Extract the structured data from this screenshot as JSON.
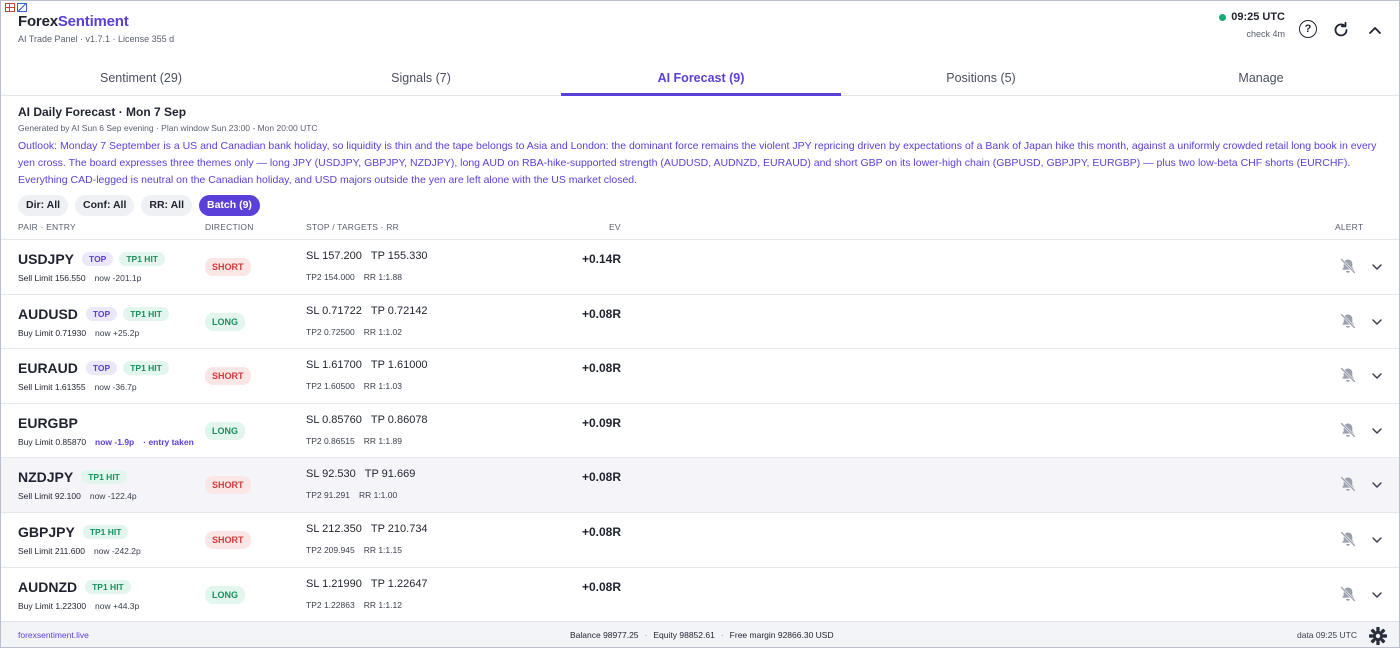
{
  "header": {
    "brand_part1": "Forex",
    "brand_part2": "Sentiment",
    "subtitle": "AI Trade Panel · v1.7.1 · License 355 d",
    "time": "09:25 UTC",
    "check": "check 4m",
    "help_label": "?",
    "status_color": "#19a974"
  },
  "tabs": [
    {
      "label": "Sentiment (29)",
      "active": false
    },
    {
      "label": "Signals (7)",
      "active": false
    },
    {
      "label": "AI Forecast (9)",
      "active": true
    },
    {
      "label": "Positions (5)",
      "active": false
    },
    {
      "label": "Manage",
      "active": false
    }
  ],
  "forecast": {
    "title": "AI Daily Forecast · Mon 7 Sep",
    "generated": "Generated by AI Sun 6 Sep evening · Plan window Sun 23:00 - Mon 20:00 UTC",
    "outlook": "Outlook: Monday 7 September is a US and Canadian bank holiday, so liquidity is thin and the tape belongs to Asia and London: the dominant force remains the violent JPY repricing driven by expectations of a Bank of Japan hike this month, against a uniformly crowded retail long book in every yen cross. The board expresses three themes only — long JPY (USDJPY, GBPJPY, NZDJPY), long AUD on RBA-hike-supported strength (AUDUSD, AUDNZD, EURAUD) and short GBP on its lower-high chain (GBPUSD, GBPJPY, EURGBP) — plus two low-beta CHF shorts (EURCHF). Everything CAD-legged is neutral on the Canadian holiday, and USD majors outside the yen are left alone with the US market closed."
  },
  "filters": [
    {
      "label": "Dir: All",
      "active": false
    },
    {
      "label": "Conf: All",
      "active": false
    },
    {
      "label": "RR: All",
      "active": false
    },
    {
      "label": "Batch (9)",
      "active": true
    }
  ],
  "columns": {
    "pair": "PAIR · ENTRY",
    "direction": "DIRECTION",
    "stops": "STOP / TARGETS · RR",
    "ev": "EV",
    "alert": "ALERT"
  },
  "rows": [
    {
      "pair": "USDJPY",
      "top": "TOP",
      "tp1": "TP1 HIT",
      "entry": "Sell Limit 156.550",
      "now": "now -201.1p",
      "note": "",
      "dir": "SHORT",
      "sl": "SL 157.200",
      "tp": "TP 155.330",
      "tp2": "TP2 154.000",
      "rr": "RR 1:1.88",
      "ev": "+0.14R"
    },
    {
      "pair": "AUDUSD",
      "top": "TOP",
      "tp1": "TP1 HIT",
      "entry": "Buy Limit 0.71930",
      "now": "now +25.2p",
      "note": "",
      "dir": "LONG",
      "sl": "SL 0.71722",
      "tp": "TP 0.72142",
      "tp2": "TP2 0.72500",
      "rr": "RR 1:1.02",
      "ev": "+0.08R"
    },
    {
      "pair": "EURAUD",
      "top": "TOP",
      "tp1": "TP1 HIT",
      "entry": "Sell Limit 1.61355",
      "now": "now -36.7p",
      "note": "",
      "dir": "SHORT",
      "sl": "SL 1.61700",
      "tp": "TP 1.61000",
      "tp2": "TP2 1.60500",
      "rr": "RR 1:1.03",
      "ev": "+0.08R"
    },
    {
      "pair": "EURGBP",
      "top": "",
      "tp1": "",
      "entry": "Buy Limit 0.85870",
      "now": "now -1.9p",
      "note": "· entry taken",
      "dir": "LONG",
      "sl": "SL 0.85760",
      "tp": "TP 0.86078",
      "tp2": "TP2 0.86515",
      "rr": "RR 1:1.89",
      "ev": "+0.09R"
    },
    {
      "pair": "NZDJPY",
      "top": "",
      "tp1": "TP1 HIT",
      "entry": "Sell Limit 92.100",
      "now": "now -122.4p",
      "note": "",
      "dir": "SHORT",
      "sl": "SL 92.530",
      "tp": "TP 91.669",
      "tp2": "TP2 91.291",
      "rr": "RR 1:1.00",
      "ev": "+0.08R"
    },
    {
      "pair": "GBPJPY",
      "top": "",
      "tp1": "TP1 HIT",
      "entry": "Sell Limit 211.600",
      "now": "now -242.2p",
      "note": "",
      "dir": "SHORT",
      "sl": "SL 212.350",
      "tp": "TP 210.734",
      "tp2": "TP2 209.945",
      "rr": "RR 1:1.15",
      "ev": "+0.08R"
    },
    {
      "pair": "AUDNZD",
      "top": "",
      "tp1": "TP1 HIT",
      "entry": "Buy Limit 1.22300",
      "now": "now +44.3p",
      "note": "",
      "dir": "LONG",
      "sl": "SL 1.21990",
      "tp": "TP 1.22647",
      "tp2": "TP2 1.22863",
      "rr": "RR 1:1.12",
      "ev": "+0.08R"
    }
  ],
  "footer": {
    "link": "forexsentiment.live",
    "balance": "Balance 98977.25",
    "equity": "Equity 98852.61",
    "margin": "Free margin 92866.30 USD",
    "data": "data 09:25 UTC",
    "sep": "·"
  },
  "colors": {
    "accent": "#5b3fd9",
    "short": "#d23b3b",
    "long": "#19915f"
  }
}
